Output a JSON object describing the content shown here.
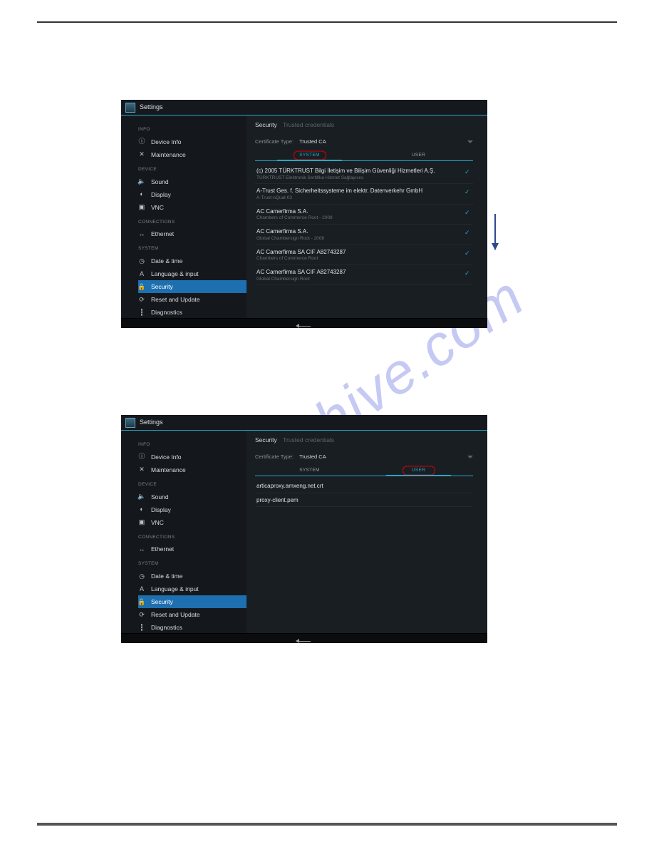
{
  "watermark": "manualshive.com",
  "app_title": "Settings",
  "sidebar": {
    "groups": [
      {
        "label": "INFO",
        "items": [
          {
            "icon": "ⓘ",
            "name": "device-info",
            "label": "Device Info"
          },
          {
            "icon": "✕",
            "name": "maintenance",
            "label": "Maintenance"
          }
        ]
      },
      {
        "label": "DEVICE",
        "items": [
          {
            "icon": "🔈",
            "name": "sound",
            "label": "Sound"
          },
          {
            "icon": "◐",
            "name": "display",
            "label": "Display"
          },
          {
            "icon": "▣",
            "name": "vnc",
            "label": "VNC"
          }
        ]
      },
      {
        "label": "CONNECTIONS",
        "items": [
          {
            "icon": "↔",
            "name": "ethernet",
            "label": "Ethernet"
          }
        ]
      },
      {
        "label": "SYSTEM",
        "items": [
          {
            "icon": "◷",
            "name": "date-time",
            "label": "Date & time"
          },
          {
            "icon": "A",
            "name": "language-input",
            "label": "Language & input"
          },
          {
            "icon": "🔒",
            "name": "security",
            "label": "Security",
            "selected": true
          },
          {
            "icon": "⟳",
            "name": "reset-update",
            "label": "Reset and Update"
          },
          {
            "icon": "┇",
            "name": "diagnostics",
            "label": "Diagnostics"
          }
        ]
      }
    ]
  },
  "content1": {
    "title": "Security",
    "subtitle": "Trusted credentials",
    "cert_type_label": "Certificate Type:",
    "cert_type_value": "Trusted CA",
    "tab_system": "SYSTEM",
    "tab_user": "USER",
    "rows": [
      {
        "t1": "(c) 2005 TÜRKTRUST Bilgi İletişim ve Bilişim Güvenliği Hizmetleri A.Ş.",
        "t2": "TÜRKTRUST Elektronik Sertifika Hizmet Sağlayıcısı"
      },
      {
        "t1": "A-Trust Ges. f. Sicherheitssysteme im elektr. Datenverkehr GmbH",
        "t2": "A-Trust-nQual-03"
      },
      {
        "t1": "AC Camerfirma S.A.",
        "t2": "Chambers of Commerce Root - 2008"
      },
      {
        "t1": "AC Camerfirma S.A.",
        "t2": "Global Chambersign Root - 2008"
      },
      {
        "t1": "AC Camerfirma SA CIF A82743287",
        "t2": "Chambers of Commerce Root"
      },
      {
        "t1": "AC Camerfirma SA CIF A82743287",
        "t2": "Global Chambersign Root"
      }
    ]
  },
  "content2": {
    "title": "Security",
    "subtitle": "Trusted credentials",
    "cert_type_label": "Certificate Type:",
    "cert_type_value": "Trusted CA",
    "tab_system": "SYSTEM",
    "tab_user": "USER",
    "rows": [
      {
        "t1": "articaproxy.amxeng.net.crt"
      },
      {
        "t1": "proxy-client.pem"
      }
    ]
  }
}
